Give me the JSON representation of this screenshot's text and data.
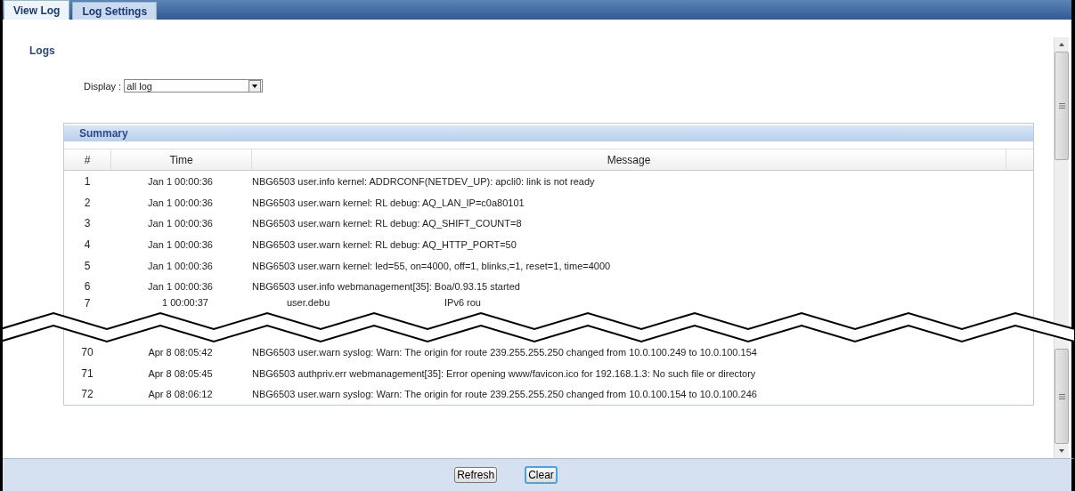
{
  "tabs": [
    {
      "label": "View Log",
      "selected": true
    },
    {
      "label": "Log Settings",
      "selected": false
    }
  ],
  "section_title": "Logs",
  "display": {
    "label": "Display :",
    "value": "all log"
  },
  "summary": {
    "title": "Summary",
    "columns": [
      "#",
      "Time",
      "Message"
    ],
    "rows": [
      {
        "kind": "row",
        "number": "1",
        "time": "Jan 1 00:00:36",
        "message": "NBG6503 user.info kernel: ADDRCONF(NETDEV_UP): apcli0: link is not ready"
      },
      {
        "kind": "row",
        "number": "2",
        "time": "Jan 1 00:00:36",
        "message": "NBG6503 user.warn kernel: RL debug: AQ_LAN_IP=c0a80101"
      },
      {
        "kind": "row",
        "number": "3",
        "time": "Jan 1 00:00:36",
        "message": "NBG6503 user.warn kernel: RL debug: AQ_SHIFT_COUNT=8"
      },
      {
        "kind": "row",
        "number": "4",
        "time": "Jan 1 00:00:36",
        "message": "NBG6503 user.warn kernel: RL debug: AQ_HTTP_PORT=50"
      },
      {
        "kind": "row",
        "number": "5",
        "time": "Jan 1 00:00:36",
        "message": "NBG6503 user.warn kernel: led=55, on=4000, off=1, blinks,=1, reset=1, time=4000"
      },
      {
        "kind": "row",
        "number": "6",
        "time": "Jan 1 00:00:36",
        "message": "NBG6503 user.info webmanagement[35]: Boa/0.93.15 started"
      },
      {
        "kind": "break",
        "number": "7",
        "time": "1 00:00:37",
        "fragments": [
          "user.debu",
          "IPv6 rou"
        ]
      },
      {
        "kind": "row",
        "number": "70",
        "time": "Apr 8 08:05:42",
        "message": "NBG6503 user.warn syslog: Warn: The origin for route 239.255.255.250 changed from 10.0.100.249 to 10.0.100.154"
      },
      {
        "kind": "row",
        "number": "71",
        "time": "Apr 8 08:05:45",
        "message": "NBG6503 authpriv.err webmanagement[35]: Error opening www/favicon.ico for 192.168.1.3: No such file or directory"
      },
      {
        "kind": "row",
        "number": "72",
        "time": "Apr 8 08:06:12",
        "message": "NBG6503 user.warn syslog: Warn: The origin for route 239.255.255.250 changed from 10.0.100.154 to 10.0.100.246"
      }
    ]
  },
  "buttons": [
    {
      "label": "Refresh",
      "focused": false
    },
    {
      "label": "Clear",
      "focused": true
    }
  ]
}
